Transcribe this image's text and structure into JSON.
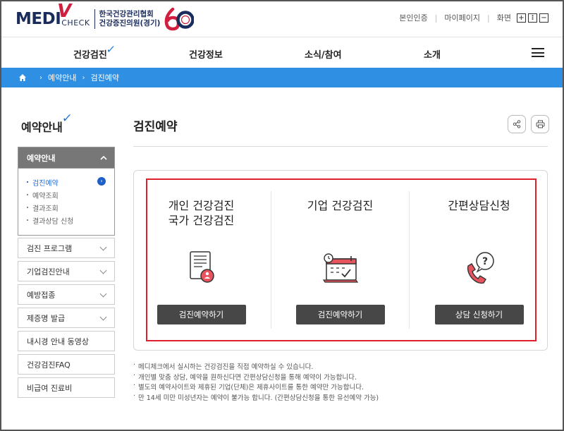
{
  "header": {
    "logo": {
      "main": "MEDI",
      "sub": "CHECK",
      "org_line1": "한국건강관리협회",
      "org_line2": "건강증진의원(경기)",
      "anniv": "60"
    },
    "util": {
      "verify": "본인인증",
      "mypage": "마이페이지",
      "screen": "화면",
      "zoom_in": "+",
      "zoom_reset": "⁝",
      "zoom_out": "−"
    }
  },
  "nav": {
    "items": [
      "건강검진",
      "건강정보",
      "소식/참여",
      "소개"
    ],
    "check": "✓"
  },
  "breadcrumb": {
    "items": [
      "예약안내",
      "검진예약"
    ]
  },
  "sidebar": {
    "title": "예약안내",
    "active_group": {
      "label": "예약안내",
      "subitems": [
        "검진예약",
        "예약조회",
        "결과조회",
        "결과상담 신청"
      ]
    },
    "items": [
      "검진 프로그램",
      "기업검진안내",
      "예방접종",
      "제증명 발급",
      "내시경 안내 동영상",
      "건강검진FAQ",
      "비급여 진료비"
    ]
  },
  "main": {
    "title": "검진예약",
    "share": "share-icon",
    "print": "print-icon",
    "columns": [
      {
        "title_line1": "개인 건강검진",
        "title_line2": "국가 건강검진",
        "icon": "document-user-icon",
        "button": "검진예약하기"
      },
      {
        "title_line1": "기업 건강검진",
        "title_line2": "",
        "icon": "calendar-icon",
        "button": "검진예약하기"
      },
      {
        "title_line1": "간편상담신청",
        "title_line2": "",
        "icon": "phone-question-icon",
        "button": "상담 신청하기"
      }
    ],
    "notes": [
      "메디체크에서 실시하는 건강검진을 직접 예약하실 수 있습니다.",
      "개인별 맞춤 상담, 예약을 원하신다면 간편상담신청을 통해 예약이 가능합니다.",
      "별도의 예약사이트와 제휴된 기업(단체)은 제휴사이트를 통한 예약만 가능합니다.",
      "만 14세 미만 미성년자는 예약이 불가능 합니다. (간편상담신청을 통한 유선예약 가능)"
    ]
  },
  "colors": {
    "brand_navy": "#1a2c5b",
    "brand_red": "#d11f3f",
    "accent_blue": "#2e8fe3",
    "highlight_red": "#e0202c"
  }
}
